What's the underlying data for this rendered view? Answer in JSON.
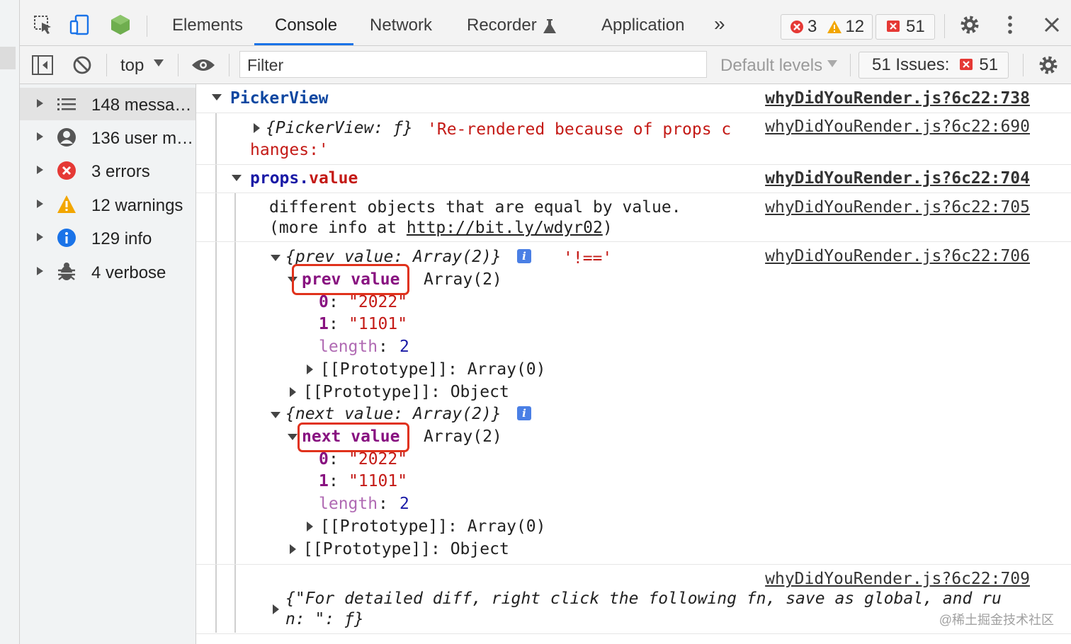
{
  "toolbar": {
    "tabs": [
      "Elements",
      "Console",
      "Network",
      "Recorder",
      "Application"
    ],
    "more": "»",
    "errors_count": "3",
    "warnings_count": "12",
    "issues_count": "51"
  },
  "toolbar2": {
    "context": "top",
    "filter_placeholder": "Filter",
    "levels": "Default levels",
    "issues_label": "51 Issues:",
    "issues_count": "51"
  },
  "sidebar": {
    "items": [
      {
        "label": "148 messa…",
        "icon": "list-icon"
      },
      {
        "label": "136 user m…",
        "icon": "user-icon"
      },
      {
        "label": "3 errors",
        "icon": "error-icon"
      },
      {
        "label": "12 warnings",
        "icon": "warning-icon"
      },
      {
        "label": "129 info",
        "icon": "info-icon"
      },
      {
        "label": "4 verbose",
        "icon": "bug-icon"
      }
    ]
  },
  "console": {
    "group_title": "PickerView",
    "src_738": "whyDidYouRender.js?6c22:738",
    "src_690": "whyDidYouRender.js?6c22:690",
    "src_704": "whyDidYouRender.js?6c22:704",
    "src_705": "whyDidYouRender.js?6c22:705",
    "src_706": "whyDidYouRender.js?6c22:706",
    "src_709": "whyDidYouRender.js?6c22:709",
    "log1_obj": "{PickerView: ƒ}",
    "log1_msg_a": "'Re-rendered because of props c",
    "log1_msg_b": "hanges:'",
    "props_obj": "props",
    "props_dot": ".",
    "props_key": "value",
    "diff_line1": "different objects that are equal by value.",
    "diff_line2_a": "(more info at ",
    "diff_link": "http://bit.ly/wdyr02",
    "diff_line2_b": ")",
    "prev_obj": "{prev value: Array(2)}",
    "neq": "'!=='",
    "prev_key": "prev value",
    "next_obj": "{next value: Array(2)}",
    "next_key": "next value",
    "array_summary": "Array(2)",
    "idx0": "0",
    "idx1": "1",
    "val0": "\"2022\"",
    "val1": "\"1101\"",
    "length_key": "length",
    "length_val": "2",
    "proto_array": "[[Prototype]]: Array(0)",
    "proto_object": "[[Prototype]]: Object",
    "footer_line1": "{\"For detailed diff, right click the following fn, save as global, and ru",
    "footer_line2": "n: \": ƒ}",
    "watermark": "@稀土掘金技术社区"
  }
}
